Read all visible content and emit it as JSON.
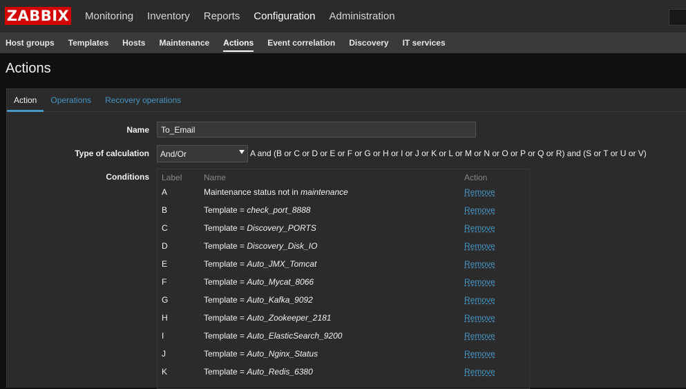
{
  "logo": "ZABBIX",
  "top_nav": [
    {
      "label": "Monitoring"
    },
    {
      "label": "Inventory"
    },
    {
      "label": "Reports"
    },
    {
      "label": "Configuration"
    },
    {
      "label": "Administration"
    }
  ],
  "sub_nav": [
    {
      "label": "Host groups"
    },
    {
      "label": "Templates"
    },
    {
      "label": "Hosts"
    },
    {
      "label": "Maintenance"
    },
    {
      "label": "Actions"
    },
    {
      "label": "Event correlation"
    },
    {
      "label": "Discovery"
    },
    {
      "label": "IT services"
    }
  ],
  "page_title": "Actions",
  "tabs": [
    {
      "label": "Action"
    },
    {
      "label": "Operations"
    },
    {
      "label": "Recovery operations"
    }
  ],
  "form": {
    "name_label": "Name",
    "name_value": "To_Email",
    "calc_label": "Type of calculation",
    "calc_value": "And/Or",
    "formula": "A and (B or C or D or E or F or G or H or I or J or K or L or M or N or O or P or Q or R) and (S or T or U or V)",
    "conditions_label": "Conditions"
  },
  "conditions": {
    "headers": {
      "label": "Label",
      "name": "Name",
      "action": "Action"
    },
    "rows": [
      {
        "label": "A",
        "prefix": "Maintenance status not in ",
        "value": "maintenance",
        "action": "Remove"
      },
      {
        "label": "B",
        "prefix": "Template = ",
        "value": "check_port_8888",
        "action": "Remove"
      },
      {
        "label": "C",
        "prefix": "Template = ",
        "value": "Discovery_PORTS",
        "action": "Remove"
      },
      {
        "label": "D",
        "prefix": "Template = ",
        "value": "Discovery_Disk_IO",
        "action": "Remove"
      },
      {
        "label": "E",
        "prefix": "Template = ",
        "value": "Auto_JMX_Tomcat",
        "action": "Remove"
      },
      {
        "label": "F",
        "prefix": "Template = ",
        "value": "Auto_Mycat_8066",
        "action": "Remove"
      },
      {
        "label": "G",
        "prefix": "Template = ",
        "value": "Auto_Kafka_9092",
        "action": "Remove"
      },
      {
        "label": "H",
        "prefix": "Template = ",
        "value": "Auto_Zookeeper_2181",
        "action": "Remove"
      },
      {
        "label": "I",
        "prefix": "Template = ",
        "value": "Auto_ElasticSearch_9200",
        "action": "Remove"
      },
      {
        "label": "J",
        "prefix": "Template = ",
        "value": "Auto_Nginx_Status",
        "action": "Remove"
      },
      {
        "label": "K",
        "prefix": "Template = ",
        "value": "Auto_Redis_6380",
        "action": "Remove"
      }
    ]
  },
  "colors": {
    "brand": "#d40000",
    "link": "#4796c4",
    "background": "#0e1012",
    "panel": "#2b2b2b"
  }
}
